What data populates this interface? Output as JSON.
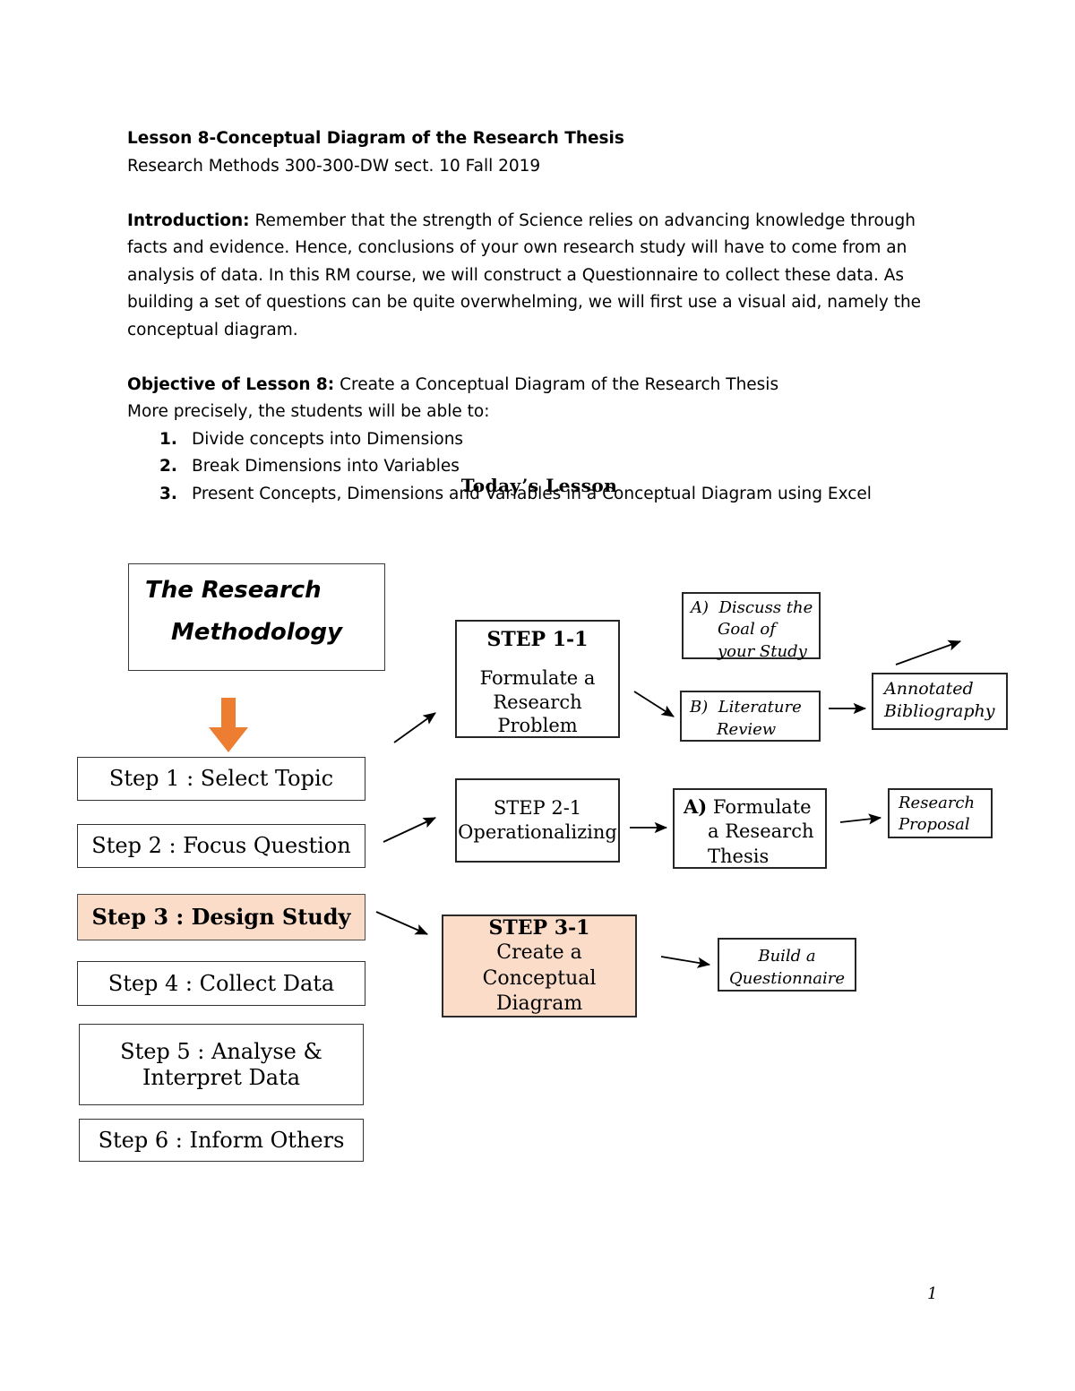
{
  "document": {
    "title_line": "Lesson 8-Conceptual Diagram of the Research Thesis",
    "course_line": "Research Methods 300-300-DW sect. 10 Fall 2019",
    "introduction": {
      "label": "Introduction:",
      "body": " Remember that the strength of Science relies on advancing knowledge through facts and evidence. Hence, conclusions of your own research study will have to come from an analysis of data. In this RM course, we will construct a Questionnaire to collect these data. As building a set of questions can be quite overwhelming, we will first use a visual aid, namely the conceptual diagram."
    },
    "objective": {
      "label": "Objective of Lesson 8:",
      "body": " Create a Conceptual Diagram of the Research Thesis",
      "lead_in": "More precisely, the students will be able to:",
      "items": [
        {
          "num": "1.",
          "text": "Divide concepts into Dimensions"
        },
        {
          "num": "2.",
          "text": "Break Dimensions into Variables"
        },
        {
          "num": "3.",
          "text": "Present Concepts, Dimensions and Variables in a Conceptual Diagram using Excel"
        }
      ]
    },
    "section_heading": "Today’s Lesson",
    "page_number": "1"
  },
  "diagram": {
    "title_box": {
      "line1": "The Research",
      "line2": "Methodology"
    },
    "steps": [
      {
        "id": "step-1",
        "label": "Step 1 : Select Topic",
        "highlight": false
      },
      {
        "id": "step-2",
        "label": "Step 2 : Focus Question",
        "highlight": false
      },
      {
        "id": "step-3",
        "label": "Step 3 : Design Study",
        "highlight": true
      },
      {
        "id": "step-4",
        "label": "Step 4 : Collect Data",
        "highlight": false
      },
      {
        "id": "step-5",
        "label": "Step 5 : Analyse & Interpret Data",
        "line1": "Step 5 : Analyse &",
        "line2": "Interpret Data",
        "highlight": false
      },
      {
        "id": "step-6",
        "label": "Step 6 : Inform Others",
        "highlight": false
      }
    ],
    "step_1_1": {
      "header": "STEP 1-1",
      "body_line1": "Formulate a",
      "body_line2": "Research",
      "body_line3": "Problem"
    },
    "step_2_1": {
      "line1": "STEP 2-1",
      "line2": "Operationalizing"
    },
    "step_3_1": {
      "header": "STEP 3-1",
      "line2": "Create a",
      "line3": "Conceptual",
      "line4": "Diagram"
    },
    "goal_box": {
      "label": "A)",
      "line1": "Discuss the",
      "line2": "Goal of",
      "line3": "your Study"
    },
    "literature_box": {
      "label": "B)",
      "line1": "Literature",
      "line2": "Review"
    },
    "annotated_box": {
      "line1": "Annotated",
      "line2": "Bibliography"
    },
    "thesis_box": {
      "label": "A)",
      "line1": "Formulate",
      "line2": "a Research",
      "line3": "Thesis"
    },
    "proposal_box": {
      "line1": "Research",
      "line2": "Proposal"
    },
    "questionnaire_box": {
      "line1": "Build a",
      "line2": "Questionnaire"
    },
    "colors": {
      "highlight_fill": "#FADCC9",
      "orange_arrow": "#ED7D31",
      "box_border": "#262626",
      "text": "#000000"
    }
  }
}
